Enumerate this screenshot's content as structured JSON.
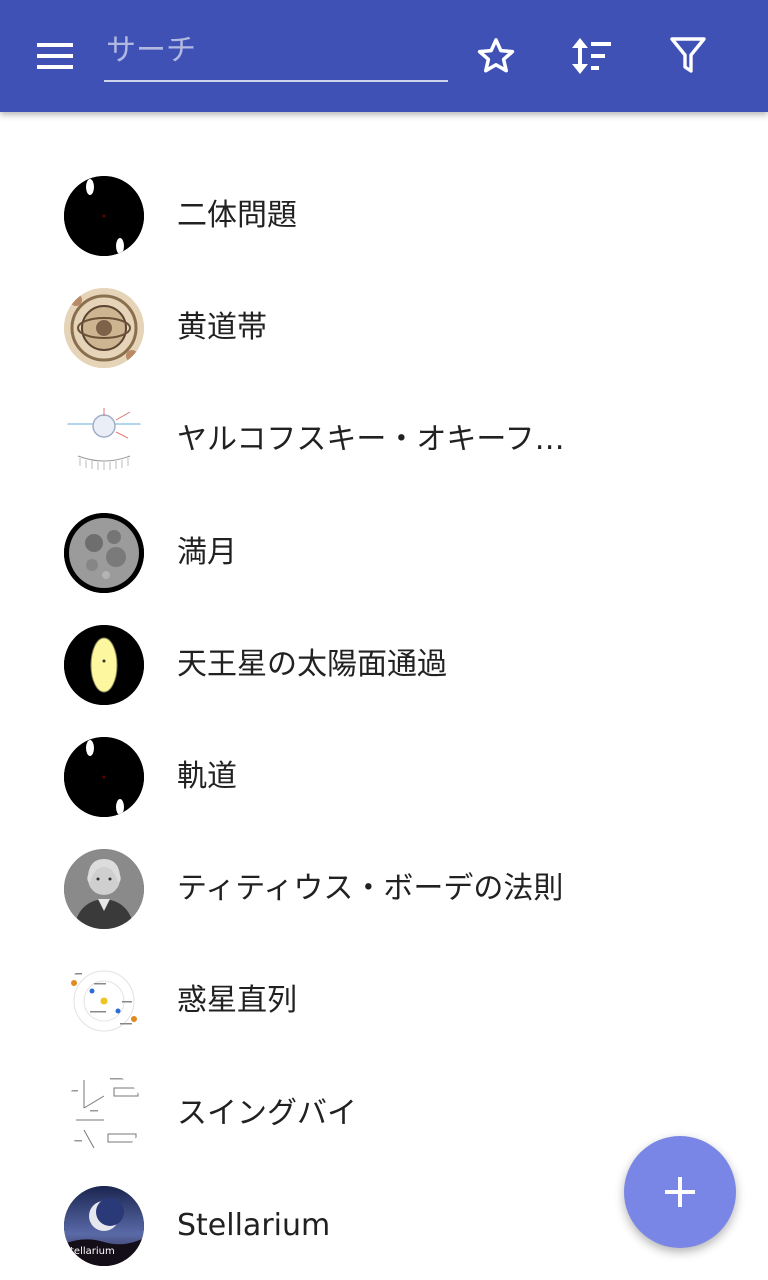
{
  "toolbar": {
    "search_placeholder": "サーチ",
    "search_value": "",
    "menu_icon": "hamburger-menu-icon",
    "favorite_icon": "star-outline-icon",
    "sort_icon": "sort-icon",
    "filter_icon": "filter-icon",
    "background_color": "#3f51b5"
  },
  "articles": [
    {
      "title": "二体問題",
      "thumbnail": "two-body-orbit"
    },
    {
      "title": "黄道帯",
      "thumbnail": "zodiac-engraving"
    },
    {
      "title": "ヤルコフスキー・オキーフ…",
      "thumbnail": "yarkovsky-diagram"
    },
    {
      "title": "満月",
      "thumbnail": "full-moon"
    },
    {
      "title": "天王星の太陽面通過",
      "thumbnail": "uranus-transit"
    },
    {
      "title": "軌道",
      "thumbnail": "two-body-orbit"
    },
    {
      "title": "ティティウス・ボーデの法則",
      "thumbnail": "bode-portrait"
    },
    {
      "title": "惑星直列",
      "thumbnail": "planet-conjunction-diagram"
    },
    {
      "title": "スイングバイ",
      "thumbnail": "swingby-diagram"
    },
    {
      "title": "Stellarium",
      "thumbnail": "stellarium-logo"
    }
  ],
  "fab": {
    "icon": "plus-icon",
    "color": "#7986e6"
  }
}
